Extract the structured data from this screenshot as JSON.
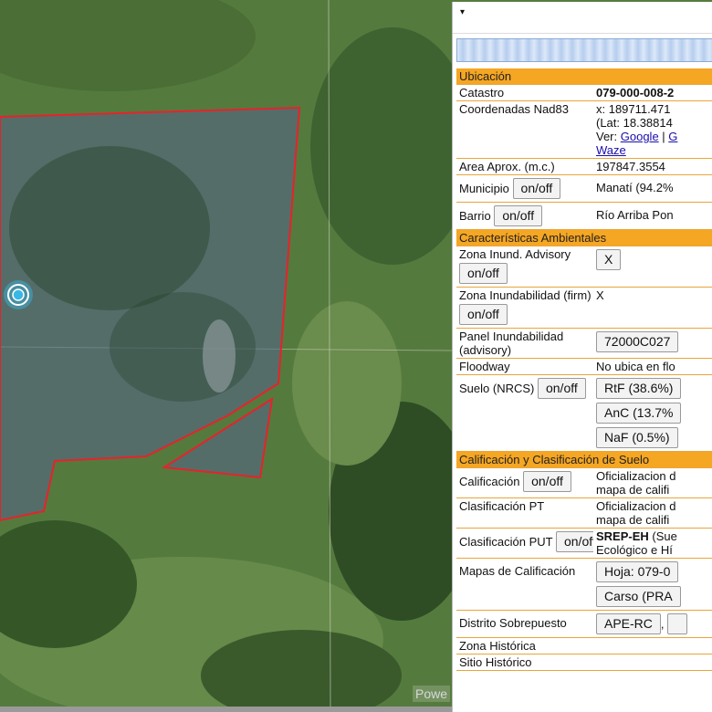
{
  "map": {
    "attribution": "Powe",
    "colors": {
      "parcel_outline": "#e8222a",
      "marker": "#39b7e6"
    }
  },
  "panel": {
    "dropdown_icon": "▾",
    "sections": {
      "ubicacion": "Ubicación",
      "ambiental": "Características Ambientales",
      "calificacion": "Calificación y Clasificación de Suelo"
    },
    "rows": {
      "catastro": {
        "label": "Catastro",
        "value": "079-000-008-2"
      },
      "coordenadas": {
        "label": "Coordenadas Nad83",
        "line1": "x: 189711.471",
        "line2": "(Lat: 18.38814",
        "ver": "Ver:",
        "google": "Google",
        "sep": " | ",
        "other": "G",
        "waze": "Waze"
      },
      "area": {
        "label": "Area Aprox. (m.c.)",
        "value": "197847.3554"
      },
      "municipio": {
        "label": "Municipio",
        "toggle": "on/off",
        "value": "Manatí (94.2%"
      },
      "barrio": {
        "label": "Barrio",
        "toggle": "on/off",
        "value": "Río Arriba Pon"
      },
      "zona_inund_adv": {
        "label": "Zona Inund. Advisory",
        "toggle": "on/off",
        "value": "X"
      },
      "zona_inund_firm": {
        "label": "Zona Inundabilidad (firm)",
        "toggle": "on/off",
        "value": "X"
      },
      "panel_inund": {
        "label": "Panel Inundabilidad (advisory)",
        "value": "72000C027"
      },
      "floodway": {
        "label": "Floodway",
        "value": "No ubica en flo"
      },
      "suelo": {
        "label": "Suelo (NRCS)",
        "toggle": "on/off",
        "values": [
          "RtF (38.6%)",
          "AnC (13.7%",
          "NaF (0.5%)"
        ]
      },
      "calificacion": {
        "label": "Calificación",
        "toggle": "on/off",
        "line1": "Oficializacion d",
        "line2": "mapa de califi"
      },
      "clasificacion_pt": {
        "label": "Clasificación PT",
        "line1": "Oficializacion d",
        "line2": "mapa de califi"
      },
      "clasificacion_put": {
        "label": "Clasificación PUT",
        "toggle": "on/off",
        "code": "SREP-EH",
        "rest": " (Sue",
        "line2": "Ecológico e Hí"
      },
      "mapas": {
        "label": "Mapas de Calificación",
        "btn1": "Hoja: 079-0",
        "btn2": "Carso (PRA"
      },
      "distrito": {
        "label": "Distrito Sobrepuesto",
        "btn1": "APE-RC",
        "sep": ","
      },
      "zona_historica": {
        "label": "Zona Histórica"
      },
      "sitio_historico": {
        "label": "Sitio Histórico"
      }
    }
  }
}
